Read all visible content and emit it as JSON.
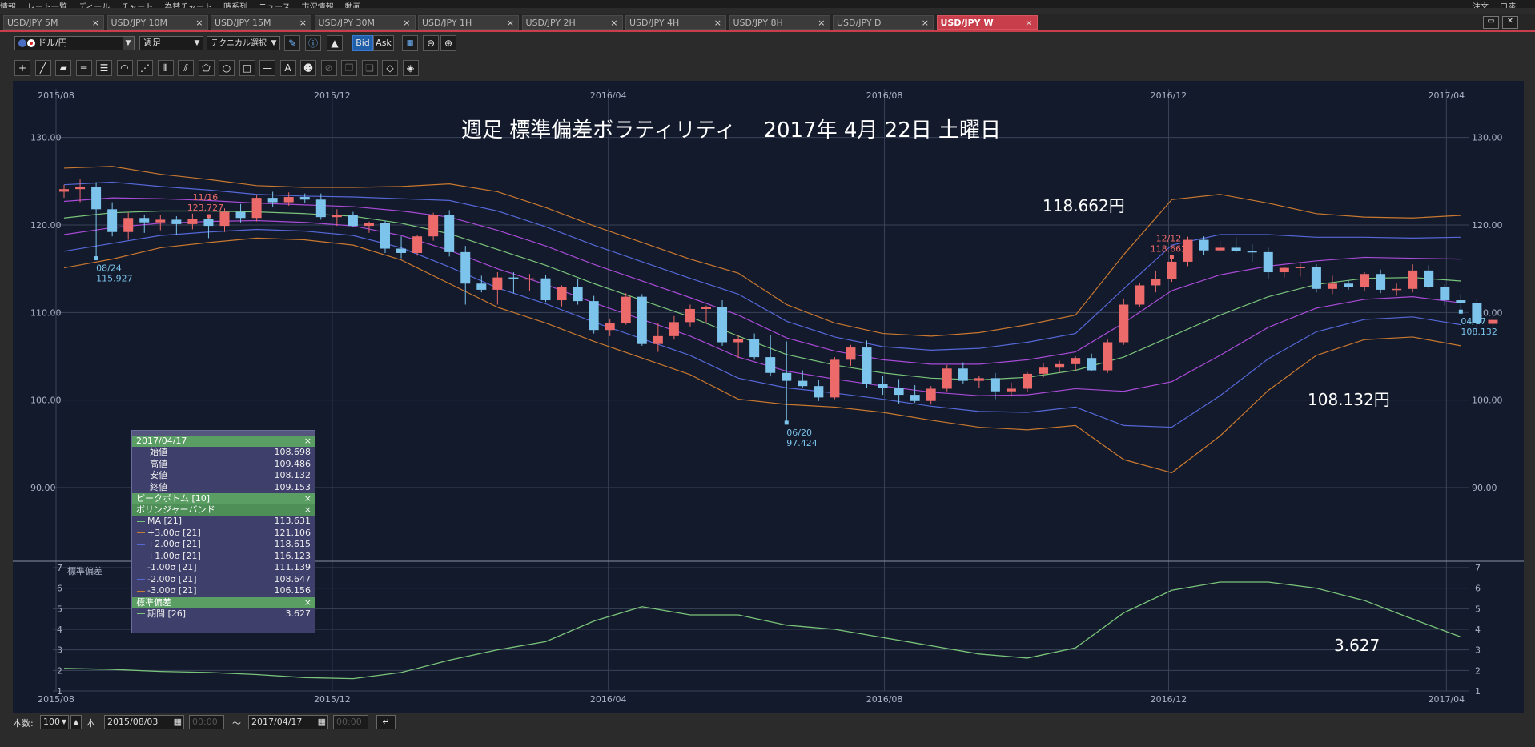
{
  "menu": {
    "items": [
      "情報",
      "レート一覧",
      "ディール",
      "チャート",
      "為替チャート",
      "時系列",
      "ニュース",
      "市況情報",
      "動画"
    ],
    "right_items": [
      "注文",
      "口座"
    ]
  },
  "tabs": [
    {
      "label": "USD/JPY 5M",
      "active": false
    },
    {
      "label": "USD/JPY 10M",
      "active": false
    },
    {
      "label": "USD/JPY 15M",
      "active": false
    },
    {
      "label": "USD/JPY 30M",
      "active": false
    },
    {
      "label": "USD/JPY 1H",
      "active": false
    },
    {
      "label": "USD/JPY 2H",
      "active": false
    },
    {
      "label": "USD/JPY 4H",
      "active": false
    },
    {
      "label": "USD/JPY 8H",
      "active": false
    },
    {
      "label": "USD/JPY D",
      "active": false
    },
    {
      "label": "USD/JPY W",
      "active": true
    }
  ],
  "tab_close": "×",
  "toolbar": {
    "pair": "ドル/円",
    "period": "週足",
    "technical": "テクニカル選択",
    "bid": "Bid",
    "ask": "Ask"
  },
  "drawing_tools": [
    "crosshair-icon",
    "trendline-icon",
    "ruler-icon",
    "channel-icon",
    "multi-line-icon",
    "arc-icon",
    "fan-icon",
    "vertical-lines-icon",
    "pitchfork-icon",
    "pentagon-icon",
    "circle-icon",
    "rectangle-icon",
    "horizontal-line-icon",
    "text-icon",
    "icon-stamp-icon",
    "delete-icon",
    "copy-icon",
    "paste-icon",
    "erase-icon",
    "erase-all-icon"
  ],
  "annotations": {
    "title": "週足 標準偏差ボラティリティ　 2017年 4月 22日 土曜日",
    "high_callout": "118.662円",
    "last_callout": "108.132円",
    "std_callout": "3.627"
  },
  "info_panel": {
    "date": "2017/04/17",
    "ohlc": [
      {
        "label": "始値",
        "value": "108.698"
      },
      {
        "label": "高値",
        "value": "109.486"
      },
      {
        "label": "安値",
        "value": "108.132"
      },
      {
        "label": "終値",
        "value": "109.153"
      }
    ],
    "peak_section": "ピークボトム [10]",
    "bb_section": "ボリンジャーバンド",
    "bb_rows": [
      {
        "label": "MA [21]",
        "value": "113.631",
        "color": "#7ac47a"
      },
      {
        "label": "+3.00σ [21]",
        "value": "121.106",
        "color": "#c9782f"
      },
      {
        "label": "+2.00σ [21]",
        "value": "118.615",
        "color": "#5568d8"
      },
      {
        "label": "+1.00σ [21]",
        "value": "116.123",
        "color": "#a84bd6"
      },
      {
        "label": "-1.00σ [21]",
        "value": "111.139",
        "color": "#a84bd6"
      },
      {
        "label": "-2.00σ [21]",
        "value": "108.647",
        "color": "#5568d8"
      },
      {
        "label": "-3.00σ [21]",
        "value": "106.156",
        "color": "#c9782f"
      }
    ],
    "std_section": "標準偏差",
    "std_row": {
      "label": "期間 [26]",
      "value": "3.627",
      "color": "#7ac47a"
    },
    "close": "×"
  },
  "bottom": {
    "count_label": "本数:",
    "count_value": "100",
    "count_unit": "本",
    "from_date": "2015/08/03",
    "from_time": "00:00",
    "tilde": "〜",
    "to_date": "2017/04/17",
    "to_time": "00:00"
  },
  "chart_data": {
    "type": "candlestick",
    "x_ticks": [
      "2015/08",
      "2015/12",
      "2016/04",
      "2016/08",
      "2016/12",
      "2017/04"
    ],
    "y_ticks": [
      "90.00",
      "100.00",
      "110.00",
      "120.00",
      "130.00"
    ],
    "ylim": [
      82.5,
      135
    ],
    "sub_panel_label": "標準偏差",
    "sub_ticks": [
      "1",
      "2",
      "3",
      "4",
      "5",
      "6",
      "7"
    ],
    "sub_ylim": [
      1,
      7
    ],
    "markers": [
      {
        "week": 9,
        "label": "11/16",
        "value": "123.727",
        "kind": "high"
      },
      {
        "week": 2,
        "label": "08/24",
        "value": "115.927",
        "kind": "low"
      },
      {
        "week": 45,
        "label": "06/20",
        "value": "97.424",
        "kind": "low"
      },
      {
        "week": 69,
        "label": "12/12",
        "value": "118.662",
        "kind": "high"
      },
      {
        "week": 87,
        "label": "04/17",
        "value": "108.132",
        "kind": "low"
      }
    ],
    "candles": [
      {
        "o": 123.8,
        "h": 124.6,
        "l": 123.1,
        "c": 124.1
      },
      {
        "o": 124.1,
        "h": 125.2,
        "l": 122.6,
        "c": 124.3
      },
      {
        "o": 124.3,
        "h": 124.9,
        "l": 116.2,
        "c": 121.8
      },
      {
        "o": 121.8,
        "h": 122.6,
        "l": 118.7,
        "c": 119.2
      },
      {
        "o": 119.2,
        "h": 121.4,
        "l": 118.3,
        "c": 120.8
      },
      {
        "o": 120.8,
        "h": 121.2,
        "l": 119.1,
        "c": 120.3
      },
      {
        "o": 120.3,
        "h": 121.1,
        "l": 119.4,
        "c": 120.6
      },
      {
        "o": 120.6,
        "h": 121.0,
        "l": 118.9,
        "c": 120.1
      },
      {
        "o": 120.1,
        "h": 121.3,
        "l": 119.5,
        "c": 120.7
      },
      {
        "o": 120.7,
        "h": 121.0,
        "l": 118.5,
        "c": 119.9
      },
      {
        "o": 119.9,
        "h": 121.9,
        "l": 119.2,
        "c": 121.5
      },
      {
        "o": 121.5,
        "h": 122.4,
        "l": 120.3,
        "c": 120.8
      },
      {
        "o": 120.8,
        "h": 123.4,
        "l": 120.4,
        "c": 123.1
      },
      {
        "o": 123.1,
        "h": 123.8,
        "l": 122.1,
        "c": 122.6
      },
      {
        "o": 122.6,
        "h": 123.73,
        "l": 122.2,
        "c": 123.2
      },
      {
        "o": 123.2,
        "h": 123.6,
        "l": 122.5,
        "c": 122.9
      },
      {
        "o": 122.9,
        "h": 123.6,
        "l": 120.6,
        "c": 120.9
      },
      {
        "o": 120.9,
        "h": 121.8,
        "l": 119.9,
        "c": 121.1
      },
      {
        "o": 121.1,
        "h": 121.5,
        "l": 119.8,
        "c": 119.9
      },
      {
        "o": 119.9,
        "h": 120.4,
        "l": 119.1,
        "c": 120.2
      },
      {
        "o": 120.2,
        "h": 120.5,
        "l": 116.8,
        "c": 117.3
      },
      {
        "o": 117.3,
        "h": 118.7,
        "l": 116.2,
        "c": 116.8
      },
      {
        "o": 116.8,
        "h": 118.9,
        "l": 116.5,
        "c": 118.7
      },
      {
        "o": 118.7,
        "h": 121.4,
        "l": 118.2,
        "c": 121.1
      },
      {
        "o": 121.1,
        "h": 121.7,
        "l": 116.4,
        "c": 116.9
      },
      {
        "o": 116.9,
        "h": 117.6,
        "l": 110.9,
        "c": 113.3
      },
      {
        "o": 113.3,
        "h": 114.2,
        "l": 112.3,
        "c": 112.6
      },
      {
        "o": 112.6,
        "h": 114.6,
        "l": 110.9,
        "c": 114.0
      },
      {
        "o": 114.0,
        "h": 114.6,
        "l": 112.2,
        "c": 113.8
      },
      {
        "o": 113.8,
        "h": 114.4,
        "l": 112.5,
        "c": 113.9
      },
      {
        "o": 113.9,
        "h": 114.3,
        "l": 111.2,
        "c": 111.4
      },
      {
        "o": 111.4,
        "h": 113.1,
        "l": 110.7,
        "c": 112.9
      },
      {
        "o": 112.9,
        "h": 113.8,
        "l": 110.9,
        "c": 111.3
      },
      {
        "o": 111.3,
        "h": 111.9,
        "l": 107.6,
        "c": 108.0
      },
      {
        "o": 108.0,
        "h": 109.2,
        "l": 107.3,
        "c": 108.8
      },
      {
        "o": 108.8,
        "h": 112.2,
        "l": 108.6,
        "c": 111.8
      },
      {
        "o": 111.8,
        "h": 112.1,
        "l": 106.2,
        "c": 106.4
      },
      {
        "o": 106.4,
        "h": 108.8,
        "l": 105.5,
        "c": 107.3
      },
      {
        "o": 107.3,
        "h": 109.6,
        "l": 106.9,
        "c": 108.9
      },
      {
        "o": 108.9,
        "h": 110.9,
        "l": 108.4,
        "c": 110.4
      },
      {
        "o": 110.4,
        "h": 110.8,
        "l": 108.8,
        "c": 110.6
      },
      {
        "o": 110.6,
        "h": 111.4,
        "l": 106.2,
        "c": 106.6
      },
      {
        "o": 106.6,
        "h": 107.4,
        "l": 104.8,
        "c": 107.0
      },
      {
        "o": 107.0,
        "h": 107.6,
        "l": 104.6,
        "c": 104.9
      },
      {
        "o": 104.9,
        "h": 107.4,
        "l": 102.7,
        "c": 103.1
      },
      {
        "o": 103.1,
        "h": 106.7,
        "l": 97.42,
        "c": 102.2
      },
      {
        "o": 102.2,
        "h": 103.4,
        "l": 101.4,
        "c": 101.6
      },
      {
        "o": 101.6,
        "h": 102.3,
        "l": 99.9,
        "c": 100.3
      },
      {
        "o": 100.3,
        "h": 104.9,
        "l": 100.1,
        "c": 104.6
      },
      {
        "o": 104.6,
        "h": 106.3,
        "l": 103.9,
        "c": 106.0
      },
      {
        "o": 106.0,
        "h": 106.8,
        "l": 101.4,
        "c": 101.8
      },
      {
        "o": 101.8,
        "h": 102.8,
        "l": 100.6,
        "c": 101.4
      },
      {
        "o": 101.4,
        "h": 102.4,
        "l": 99.6,
        "c": 100.6
      },
      {
        "o": 100.6,
        "h": 101.7,
        "l": 99.7,
        "c": 99.9
      },
      {
        "o": 99.9,
        "h": 101.6,
        "l": 99.5,
        "c": 101.3
      },
      {
        "o": 101.3,
        "h": 104.0,
        "l": 101.0,
        "c": 103.6
      },
      {
        "o": 103.6,
        "h": 104.3,
        "l": 101.9,
        "c": 102.2
      },
      {
        "o": 102.2,
        "h": 102.8,
        "l": 101.4,
        "c": 102.5
      },
      {
        "o": 102.5,
        "h": 103.1,
        "l": 100.1,
        "c": 101.0
      },
      {
        "o": 101.0,
        "h": 102.0,
        "l": 100.4,
        "c": 101.3
      },
      {
        "o": 101.3,
        "h": 103.2,
        "l": 100.9,
        "c": 103.0
      },
      {
        "o": 103.0,
        "h": 104.2,
        "l": 102.6,
        "c": 103.7
      },
      {
        "o": 103.7,
        "h": 104.5,
        "l": 103.1,
        "c": 104.1
      },
      {
        "o": 104.1,
        "h": 105.0,
        "l": 103.3,
        "c": 104.8
      },
      {
        "o": 104.8,
        "h": 105.3,
        "l": 103.3,
        "c": 103.4
      },
      {
        "o": 103.4,
        "h": 106.9,
        "l": 103.1,
        "c": 106.6
      },
      {
        "o": 106.6,
        "h": 111.6,
        "l": 106.3,
        "c": 110.9
      },
      {
        "o": 110.9,
        "h": 113.4,
        "l": 110.6,
        "c": 113.1
      },
      {
        "o": 113.1,
        "h": 114.8,
        "l": 112.3,
        "c": 113.8
      },
      {
        "o": 113.8,
        "h": 116.3,
        "l": 113.5,
        "c": 115.8
      },
      {
        "o": 115.8,
        "h": 118.66,
        "l": 115.3,
        "c": 118.3
      },
      {
        "o": 118.3,
        "h": 118.7,
        "l": 116.6,
        "c": 117.1
      },
      {
        "o": 117.1,
        "h": 118.2,
        "l": 116.9,
        "c": 117.4
      },
      {
        "o": 117.4,
        "h": 118.6,
        "l": 116.8,
        "c": 117.0
      },
      {
        "o": 117.0,
        "h": 117.8,
        "l": 115.8,
        "c": 116.9
      },
      {
        "o": 116.9,
        "h": 117.4,
        "l": 113.8,
        "c": 114.6
      },
      {
        "o": 114.6,
        "h": 115.3,
        "l": 114.0,
        "c": 115.1
      },
      {
        "o": 115.1,
        "h": 115.6,
        "l": 114.1,
        "c": 115.2
      },
      {
        "o": 115.2,
        "h": 115.5,
        "l": 112.3,
        "c": 112.7
      },
      {
        "o": 112.7,
        "h": 114.2,
        "l": 112.1,
        "c": 113.3
      },
      {
        "o": 113.3,
        "h": 113.7,
        "l": 112.6,
        "c": 112.9
      },
      {
        "o": 112.9,
        "h": 114.6,
        "l": 112.5,
        "c": 114.4
      },
      {
        "o": 114.4,
        "h": 114.9,
        "l": 112.2,
        "c": 112.6
      },
      {
        "o": 112.6,
        "h": 113.3,
        "l": 111.9,
        "c": 112.7
      },
      {
        "o": 112.7,
        "h": 115.5,
        "l": 112.3,
        "c": 114.8
      },
      {
        "o": 114.8,
        "h": 115.4,
        "l": 112.7,
        "c": 112.9
      },
      {
        "o": 112.9,
        "h": 113.2,
        "l": 110.8,
        "c": 111.4
      },
      {
        "o": 111.4,
        "h": 112.1,
        "l": 110.1,
        "c": 111.1
      },
      {
        "o": 111.1,
        "h": 111.6,
        "l": 108.4,
        "c": 108.8
      },
      {
        "o": 108.7,
        "h": 109.49,
        "l": 108.13,
        "c": 109.15
      }
    ],
    "bands": {
      "weeks": [
        0,
        3,
        6,
        9,
        12,
        15,
        18,
        21,
        24,
        27,
        30,
        33,
        36,
        39,
        42,
        45,
        48,
        51,
        54,
        57,
        60,
        63,
        66,
        69,
        72,
        75,
        78,
        81,
        84,
        87
      ],
      "ma": [
        120.8,
        121.4,
        121.6,
        121.6,
        121.5,
        121.3,
        121.0,
        120.2,
        119.0,
        117.2,
        115.4,
        113.3,
        111.4,
        109.5,
        107.3,
        105.2,
        104.0,
        103.1,
        102.5,
        102.3,
        102.6,
        103.4,
        104.9,
        107.3,
        109.7,
        111.8,
        113.2,
        113.9,
        114.0,
        113.6
      ],
      "up1": [
        122.7,
        123.1,
        123.0,
        122.8,
        122.5,
        122.3,
        122.1,
        121.6,
        120.9,
        119.4,
        117.6,
        115.5,
        113.6,
        111.7,
        109.7,
        107.1,
        105.6,
        104.6,
        104.1,
        104.1,
        104.6,
        105.5,
        108.8,
        112.5,
        114.3,
        115.3,
        115.9,
        116.3,
        116.2,
        116.1
      ],
      "up2": [
        124.6,
        124.9,
        124.4,
        124.0,
        123.5,
        123.3,
        123.2,
        123.0,
        122.8,
        121.6,
        119.8,
        117.7,
        115.8,
        113.9,
        112.1,
        109.0,
        107.2,
        106.1,
        105.7,
        105.9,
        106.6,
        107.6,
        112.7,
        117.7,
        118.9,
        118.9,
        118.6,
        118.6,
        118.5,
        118.6
      ],
      "up3": [
        126.5,
        126.7,
        125.8,
        125.2,
        124.5,
        124.3,
        124.3,
        124.4,
        124.7,
        123.8,
        122.0,
        119.9,
        118.0,
        116.1,
        114.5,
        110.9,
        108.8,
        107.6,
        107.3,
        107.7,
        108.6,
        109.7,
        116.6,
        122.9,
        123.5,
        122.5,
        121.3,
        120.9,
        120.8,
        121.1
      ],
      "dn1": [
        118.9,
        119.7,
        120.2,
        120.4,
        120.5,
        120.3,
        119.9,
        118.8,
        117.1,
        115.0,
        113.2,
        111.1,
        109.2,
        107.3,
        104.9,
        103.3,
        102.4,
        101.6,
        100.9,
        100.5,
        100.6,
        101.3,
        101.0,
        102.1,
        105.1,
        108.3,
        110.5,
        111.5,
        111.8,
        111.1
      ],
      "dn2": [
        117.0,
        117.9,
        118.8,
        119.2,
        119.5,
        119.3,
        118.8,
        117.4,
        115.2,
        112.8,
        111.0,
        108.9,
        107.0,
        105.1,
        102.5,
        101.4,
        100.8,
        100.1,
        99.3,
        98.7,
        98.6,
        99.2,
        97.1,
        96.9,
        100.5,
        104.7,
        107.8,
        109.2,
        109.5,
        108.6
      ],
      "dn3": [
        115.1,
        116.1,
        117.4,
        118.0,
        118.5,
        118.3,
        117.7,
        116.0,
        113.3,
        110.6,
        108.8,
        106.7,
        104.8,
        102.9,
        100.1,
        99.5,
        99.2,
        98.6,
        97.7,
        96.9,
        96.6,
        97.1,
        93.2,
        91.7,
        95.9,
        101.1,
        105.1,
        106.9,
        107.2,
        106.2
      ]
    },
    "std_series": {
      "weeks": [
        0,
        3,
        6,
        9,
        12,
        15,
        18,
        21,
        24,
        27,
        30,
        33,
        36,
        39,
        42,
        45,
        48,
        51,
        54,
        57,
        60,
        63,
        66,
        69,
        72,
        75,
        78,
        81,
        84,
        87
      ],
      "values": [
        2.1,
        2.05,
        1.95,
        1.9,
        1.8,
        1.65,
        1.6,
        1.9,
        2.5,
        3.0,
        3.4,
        4.4,
        5.1,
        4.7,
        4.7,
        4.2,
        4.0,
        3.6,
        3.2,
        2.8,
        2.6,
        3.1,
        4.8,
        5.9,
        6.3,
        6.3,
        6.0,
        5.4,
        4.5,
        3.63
      ]
    }
  }
}
